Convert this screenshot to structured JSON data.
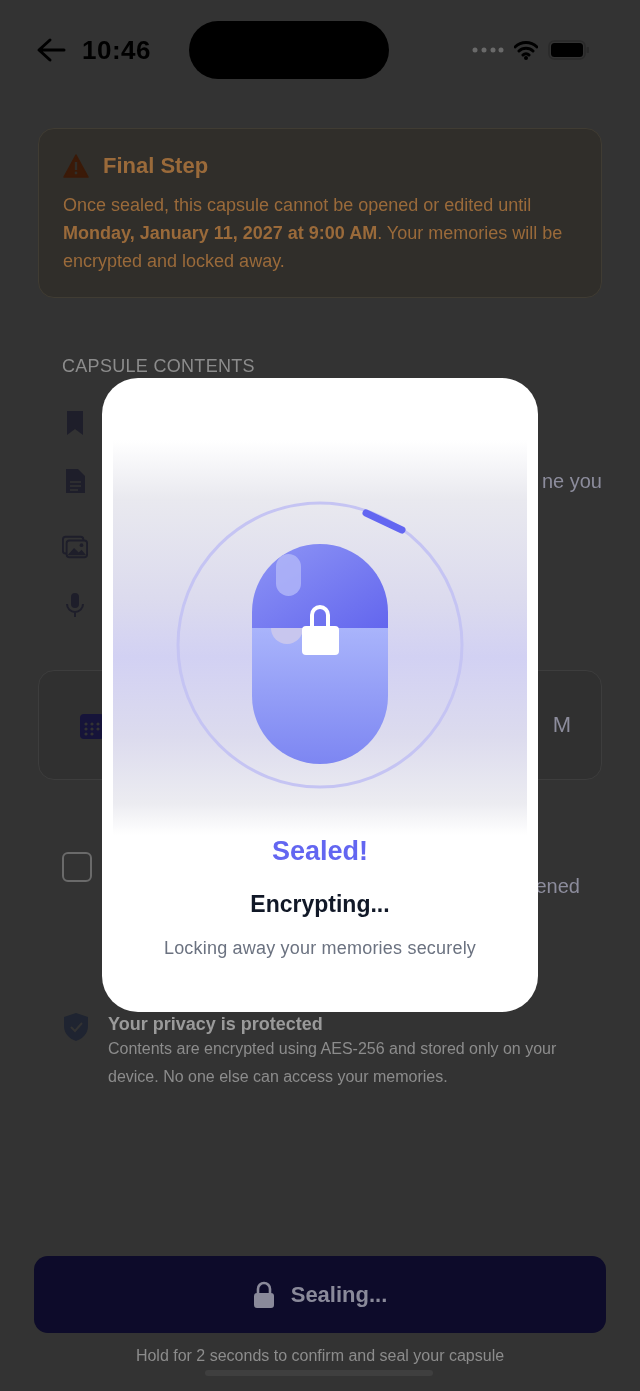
{
  "status_bar": {
    "time": "10:46"
  },
  "warning": {
    "title": "Final Step",
    "body": "Once sealed, this capsule cannot be opened or edited until **Monday, January 11, 2027 at 9:00 AM**. Your memories will be encrypted and locked away."
  },
  "contents": {
    "label": "CAPSULE CONTENTS",
    "text_fragment": "ne you"
  },
  "date_card": {
    "text_fragment": "M"
  },
  "confirm": {
    "checked": false,
    "text_fragment": "ened"
  },
  "privacy": {
    "title": "Your privacy is protected",
    "body": "Contents are encrypted using AES-256 and stored only on your device. No one else can access your memories."
  },
  "seal_button": {
    "label": "Sealing..."
  },
  "hint": "Hold for 2 seconds to confirm and seal your capsule",
  "modal": {
    "title": "Sealed!",
    "status": "Encrypting...",
    "message": "Locking away your memories securely"
  }
}
